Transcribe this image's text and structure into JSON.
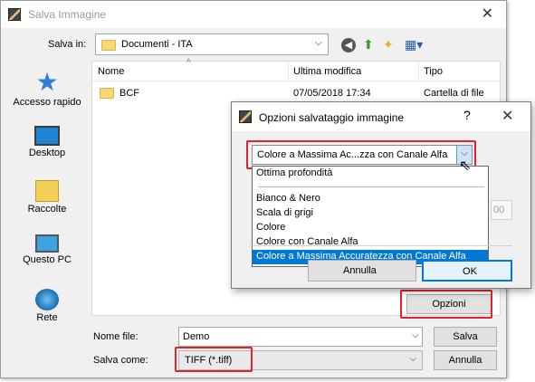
{
  "save_dialog": {
    "title": "Salva Immagine",
    "close": "✕",
    "save_in_label": "Salva in:",
    "save_in_value": "Documenti - ITA",
    "dropdown_arrow": "⌵",
    "toolbar": {
      "back_glyph": "◀",
      "up_glyph": "⬆",
      "new_folder_glyph": "✦",
      "view_glyph": "▦▾"
    },
    "places": [
      {
        "label": "Accesso rapido",
        "icon": "star-icon",
        "glyph": "★"
      },
      {
        "label": "Desktop",
        "icon": "desktop-icon"
      },
      {
        "label": "Raccolte",
        "icon": "libraries-icon"
      },
      {
        "label": "Questo PC",
        "icon": "computer-icon"
      },
      {
        "label": "Rete",
        "icon": "network-icon"
      }
    ],
    "columns": {
      "name": "Nome",
      "modified": "Ultima modifica",
      "type": "Tipo",
      "sort_glyph": "^"
    },
    "rows": [
      {
        "name": "BCF",
        "modified": "07/05/2018 17:34",
        "type": "Cartella di file"
      }
    ],
    "filename_label": "Nome file:",
    "filename_value": "Demo",
    "savetype_label": "Salva come:",
    "savetype_value": "TIFF (*.tiff)",
    "save_button": "Salva",
    "cancel_button": "Annulla",
    "options_button": "Opzioni",
    "highlight_color": "#e0242a"
  },
  "options_dialog": {
    "title": "Opzioni salvataggio immagine",
    "help": "?",
    "close": "✕",
    "depth_value": "Colore a Massima Ac...zza con Canale Alfa",
    "dropdown_arrow": "⌵",
    "cursor": "⇖",
    "dropdown_items": [
      "Ottima profondità",
      "Bianco & Nero",
      "Scala di grigi",
      "Colore",
      "Colore con Canale Alfa",
      "Colore a Massima Accuratezza con Canale Alfa"
    ],
    "selected_item": "Colore a Massima Accuratezza con Canale Alfa",
    "partial_field": "00",
    "cancel_button": "Annulla",
    "ok_button": "OK"
  }
}
